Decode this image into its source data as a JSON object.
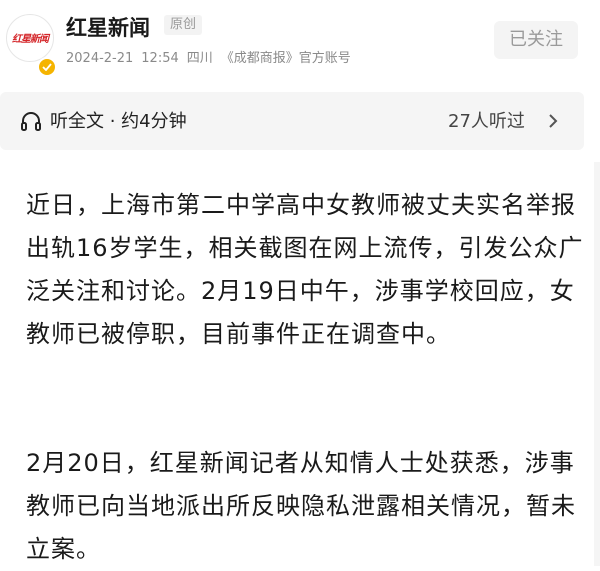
{
  "header": {
    "avatar_logo_text": "红星新闻",
    "name": "红星新闻",
    "tag": "原创",
    "date": "2024-2-21",
    "time": "12:54",
    "location": "四川",
    "source": "《成都商报》官方账号",
    "follow_label": "已关注"
  },
  "listen": {
    "label": "听全文 · 约4分钟",
    "count": "27人听过"
  },
  "article": {
    "paragraph1": "近日，上海市第二中学高中女教师被丈夫实名举报出轨16岁学生，相关截图在网上流传，引发公众广泛关注和讨论。2月19日中午，涉事学校回应，女教师已被停职，目前事件正在调查中。",
    "paragraph2": "2月20日，红星新闻记者从知情人士处获悉，涉事教师已向当地派出所反映隐私泄露相关情况，暂未立案。"
  },
  "colors": {
    "brand_red": "#d4262a",
    "verified_gold": "#f5b400",
    "muted_text": "#8a8a8a",
    "bar_bg": "#f5f5f5"
  },
  "icons": [
    "headphone-icon",
    "chevron-right-icon",
    "verified-badge-icon"
  ]
}
